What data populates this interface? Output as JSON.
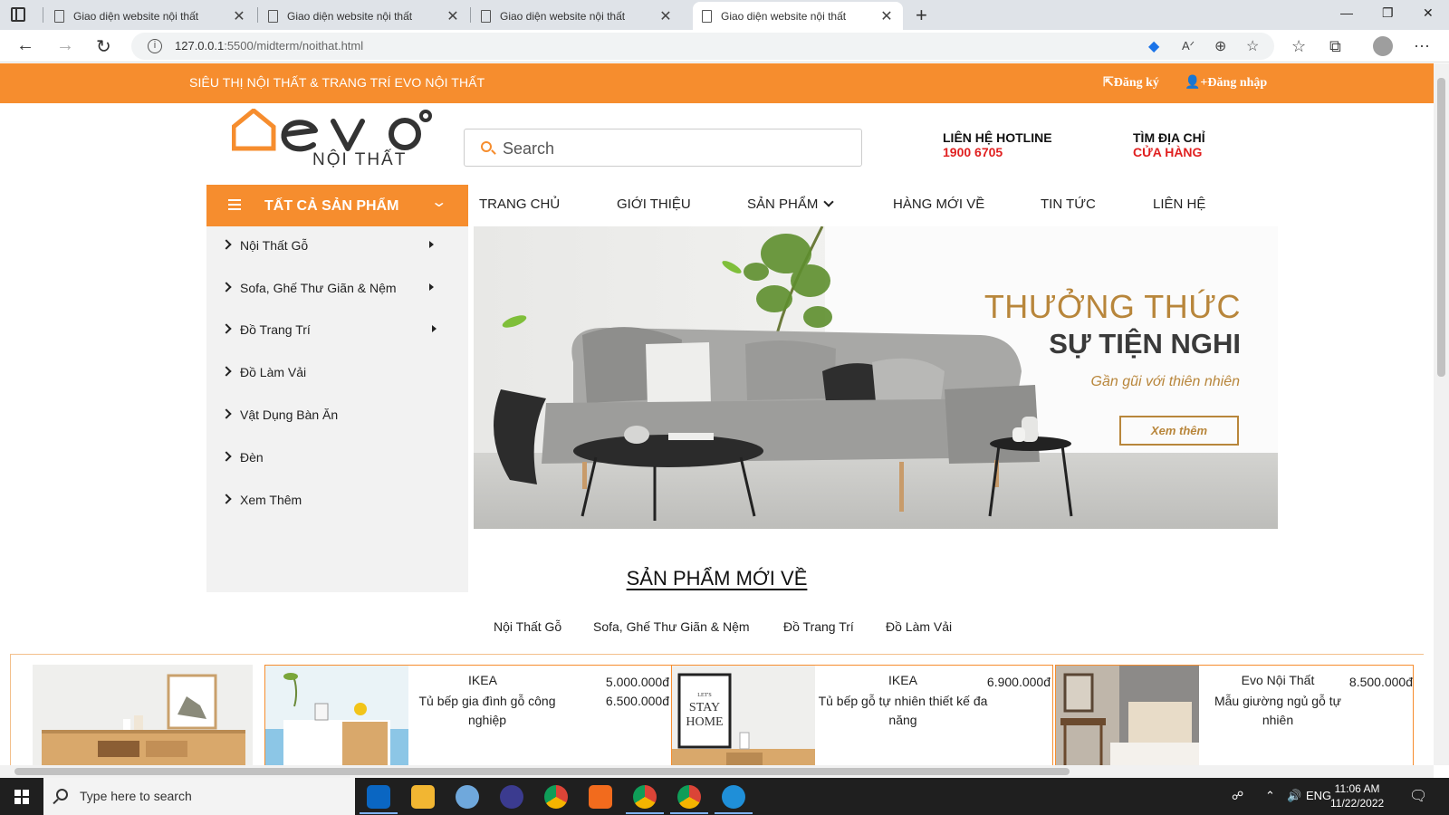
{
  "browser": {
    "tabs": [
      {
        "title": "Giao diện website nội thất"
      },
      {
        "title": "Giao diện website nội thất"
      },
      {
        "title": "Giao diện website nội thất"
      },
      {
        "title": "Giao diện website nội thất"
      }
    ],
    "url_host": "127.0.0.1",
    "url_path": ":5500/midterm/noithat.html"
  },
  "topbar": {
    "slogan": "SIÊU THỊ NỘI THẤT & TRANG TRÍ EVO NỘI THẤT",
    "register": "Đăng ký",
    "login": "Đăng nhập"
  },
  "brand": {
    "sub": "NỘI THẤT"
  },
  "search": {
    "placeholder": "Search"
  },
  "contacts": [
    {
      "line1": "LIÊN HỆ HOTLINE",
      "line2": "1900 6705"
    },
    {
      "line1": "TÌM ĐỊA CHỈ",
      "line2": "CỬA HÀNG"
    }
  ],
  "categories": {
    "title": "TẤT CẢ SẢN PHẨM",
    "items": [
      {
        "label": "Nội Thất Gỗ"
      },
      {
        "label": "Sofa, Ghế Thư Giãn & Nệm"
      },
      {
        "label": "Đồ Trang Trí"
      },
      {
        "label": "Đồ Làm Vải"
      },
      {
        "label": "Vật Dụng Bàn Ăn"
      },
      {
        "label": "Đèn"
      },
      {
        "label": "Xem Thêm"
      }
    ]
  },
  "nav": [
    "TRANG CHỦ",
    "GIỚI THIỆU",
    "SẢN PHẨM",
    "HÀNG MỚI VỀ",
    "TIN TỨC",
    "LIÊN HỆ"
  ],
  "banner": {
    "title1": "THƯỞNG THỨC",
    "title2": "SỰ TIỆN NGHI",
    "subtitle": "Gần gũi với thiên nhiên",
    "cta": "Xem thêm"
  },
  "section": {
    "title": "SẢN PHẨM MỚI VỀ",
    "filters": [
      "Nội Thất Gỗ",
      "Sofa, Ghế Thư Giãn & Nệm",
      "Đồ Trang Trí",
      "Đồ Làm Vải"
    ]
  },
  "products": [
    {
      "brand": "IKEA",
      "name": "Tủ bếp gia đình gỗ công nghiệp",
      "price": "5.000.000đ",
      "old_price": "6.500.000đ"
    },
    {
      "brand": "IKEA",
      "name": "Tủ bếp gỗ tự nhiên thiết kế đa năng",
      "price": "6.900.000đ"
    },
    {
      "brand": "Evo Nội Thất",
      "name": "Mẫu giường ngủ gỗ tự nhiên",
      "price": "8.500.000đ"
    }
  ],
  "taskbar": {
    "search_placeholder": "Type here to search",
    "lang": "ENG",
    "time": "11:06 AM",
    "date": "11/22/2022"
  },
  "colors": {
    "accent": "#f68d2e",
    "gold": "#b8863b",
    "hotline_red": "#e02020"
  }
}
